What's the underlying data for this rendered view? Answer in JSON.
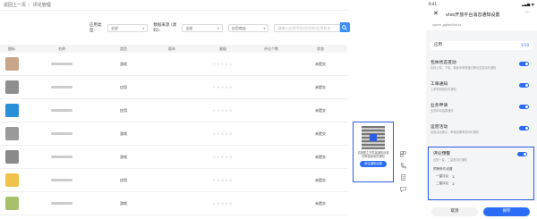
{
  "topbar": {
    "back": "返回上一页",
    "separator": "|",
    "title": "评论管理"
  },
  "filters": {
    "app_type_label": "应用类型:",
    "app_type_value": "全部",
    "data_source_label": "数据来源 (源码):",
    "data_source_value": "全部",
    "app_status_value": "应用商店",
    "search_placeholder": "请输入应用ID/应用名称/应用包名"
  },
  "table": {
    "columns": [
      "图标",
      "名称",
      "类型",
      "版本",
      "星级",
      "评论个数",
      "状态"
    ],
    "rows": [
      {
        "type": "游戏",
        "stars": 0,
        "status": "未提交",
        "thumb_color": "#c9a58a"
      },
      {
        "type": "应用",
        "stars": 0,
        "status": "未提交",
        "thumb_color": "#8f8f8f"
      },
      {
        "type": "应用",
        "stars": 0,
        "status": "未提交",
        "thumb_color": "#2a8fd9"
      },
      {
        "type": "游戏",
        "stars": 0,
        "status": "未提交",
        "thumb_color": "#9a9a9a"
      },
      {
        "type": "游戏",
        "stars": 0,
        "status": "未提交",
        "thumb_color": "#8a8a8a"
      },
      {
        "type": "应用",
        "stars": 0,
        "status": "未提交",
        "thumb_color": "#f0c24a"
      },
      {
        "type": "游戏",
        "stars": 0,
        "status": "未提交",
        "thumb_color": "#a7c06b"
      }
    ]
  },
  "qr_panel": {
    "text": "请按照主开发者通知设置您希望接收的通知",
    "button": "前往通知设置"
  },
  "phone": {
    "time": "9:41",
    "status": "▂▃▅ ◉",
    "title": "vivo开放平台消息通知设置",
    "subtitle": "vpam_ggfastfuhxs",
    "app_label": "应用",
    "app_count": "1/10",
    "notifications": [
      {
        "title": "包体状态变动",
        "desc": "包体上架、下架、新版本审核通过等状态变动时通知"
      },
      {
        "title": "工单通知",
        "desc": "工单有新回复时通知"
      },
      {
        "title": "业务申请",
        "desc": "业务申请结果通知"
      },
      {
        "title": "运营活动",
        "desc": "运营活动报名、审核结果等变动时通知"
      }
    ],
    "review": {
      "title": "评论预警",
      "desc": "出现一星、二星差评时通知",
      "sub": "预警条件设置",
      "lines": [
        {
          "label": "一星评论",
          "value": "2"
        },
        {
          "label": "二星评论",
          "value": "2"
        }
      ]
    },
    "cancel": "取消",
    "save": "保存"
  },
  "colors": {
    "accent": "#2b6cf6",
    "highlight_border": "#2b5ce6",
    "star": "#f5a623"
  }
}
